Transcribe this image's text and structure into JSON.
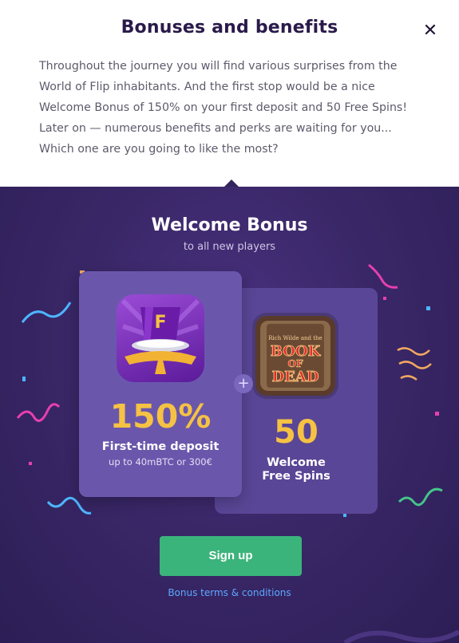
{
  "modal": {
    "title": "Bonuses and benefits",
    "close_icon": "close-icon",
    "close_glyph": "✕",
    "intro_lines": [
      "Throughout the journey you will find various surprises from the",
      "World of Flip inhabitants. And the first stop would be a nice",
      "Welcome Bonus of 150% on your first deposit and 50 Free Spins!",
      "Later on — numerous benefits and perks are waiting for you...",
      "Which one are you going to like the most?"
    ]
  },
  "promo": {
    "title": "Welcome Bonus",
    "subtitle": "to all new players",
    "deposit_card": {
      "icon": "top-hat-logo-icon",
      "logo_letter": "F",
      "percent": "150%",
      "label": "First-time deposit",
      "sub": "up to 40mBTC or 300€"
    },
    "plus_glyph": "+",
    "spins_card": {
      "icon": "book-of-dead-game-icon",
      "game_art_lines": [
        "Rich Wilde and the",
        "BOOK",
        "OF",
        "DEAD"
      ],
      "count": "50",
      "label_line1": "Welcome",
      "label_line2": "Free Spins"
    },
    "signup_label": "Sign up",
    "terms_label": "Bonus terms & conditions"
  },
  "colors": {
    "accent_gold": "#f5c243",
    "button_green": "#3bb47b",
    "link_blue": "#5da8ff",
    "panel_purple": "#3a2768"
  }
}
